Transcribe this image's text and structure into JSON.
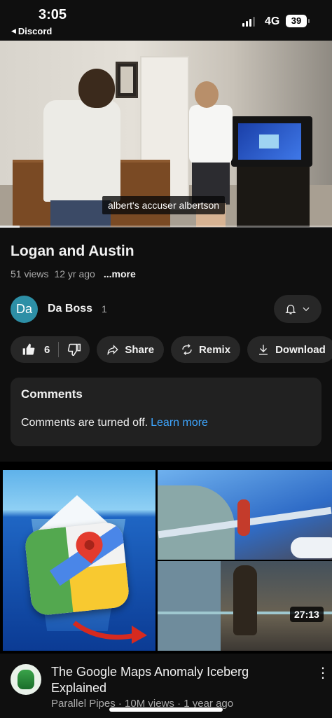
{
  "status_bar": {
    "time": "3:05",
    "back_app": "Discord",
    "network": "4G",
    "battery": "39"
  },
  "player": {
    "caption": "albert's accuser albertson",
    "progress_fraction": 0.06
  },
  "video": {
    "title": "Logan and Austin",
    "views": "51 views",
    "age": "12 yr ago",
    "more_label": "...more"
  },
  "channel": {
    "avatar_initials": "Da",
    "avatar_color": "#2d8fa6",
    "name": "Da Boss",
    "subscribers": "1"
  },
  "actions": {
    "like_count": "6",
    "share_label": "Share",
    "remix_label": "Remix",
    "download_label": "Download"
  },
  "comments": {
    "heading": "Comments",
    "status_text": "Comments are turned off.",
    "learn_more": "Learn more"
  },
  "next_video": {
    "duration": "27:13",
    "title": "The Google Maps Anomaly Iceberg Explained",
    "meta": "Parallel Pipes · 10M views · 1 year ago"
  },
  "colors": {
    "background": "#0f0f0f",
    "chip": "#272727",
    "link": "#3ea6ff"
  }
}
